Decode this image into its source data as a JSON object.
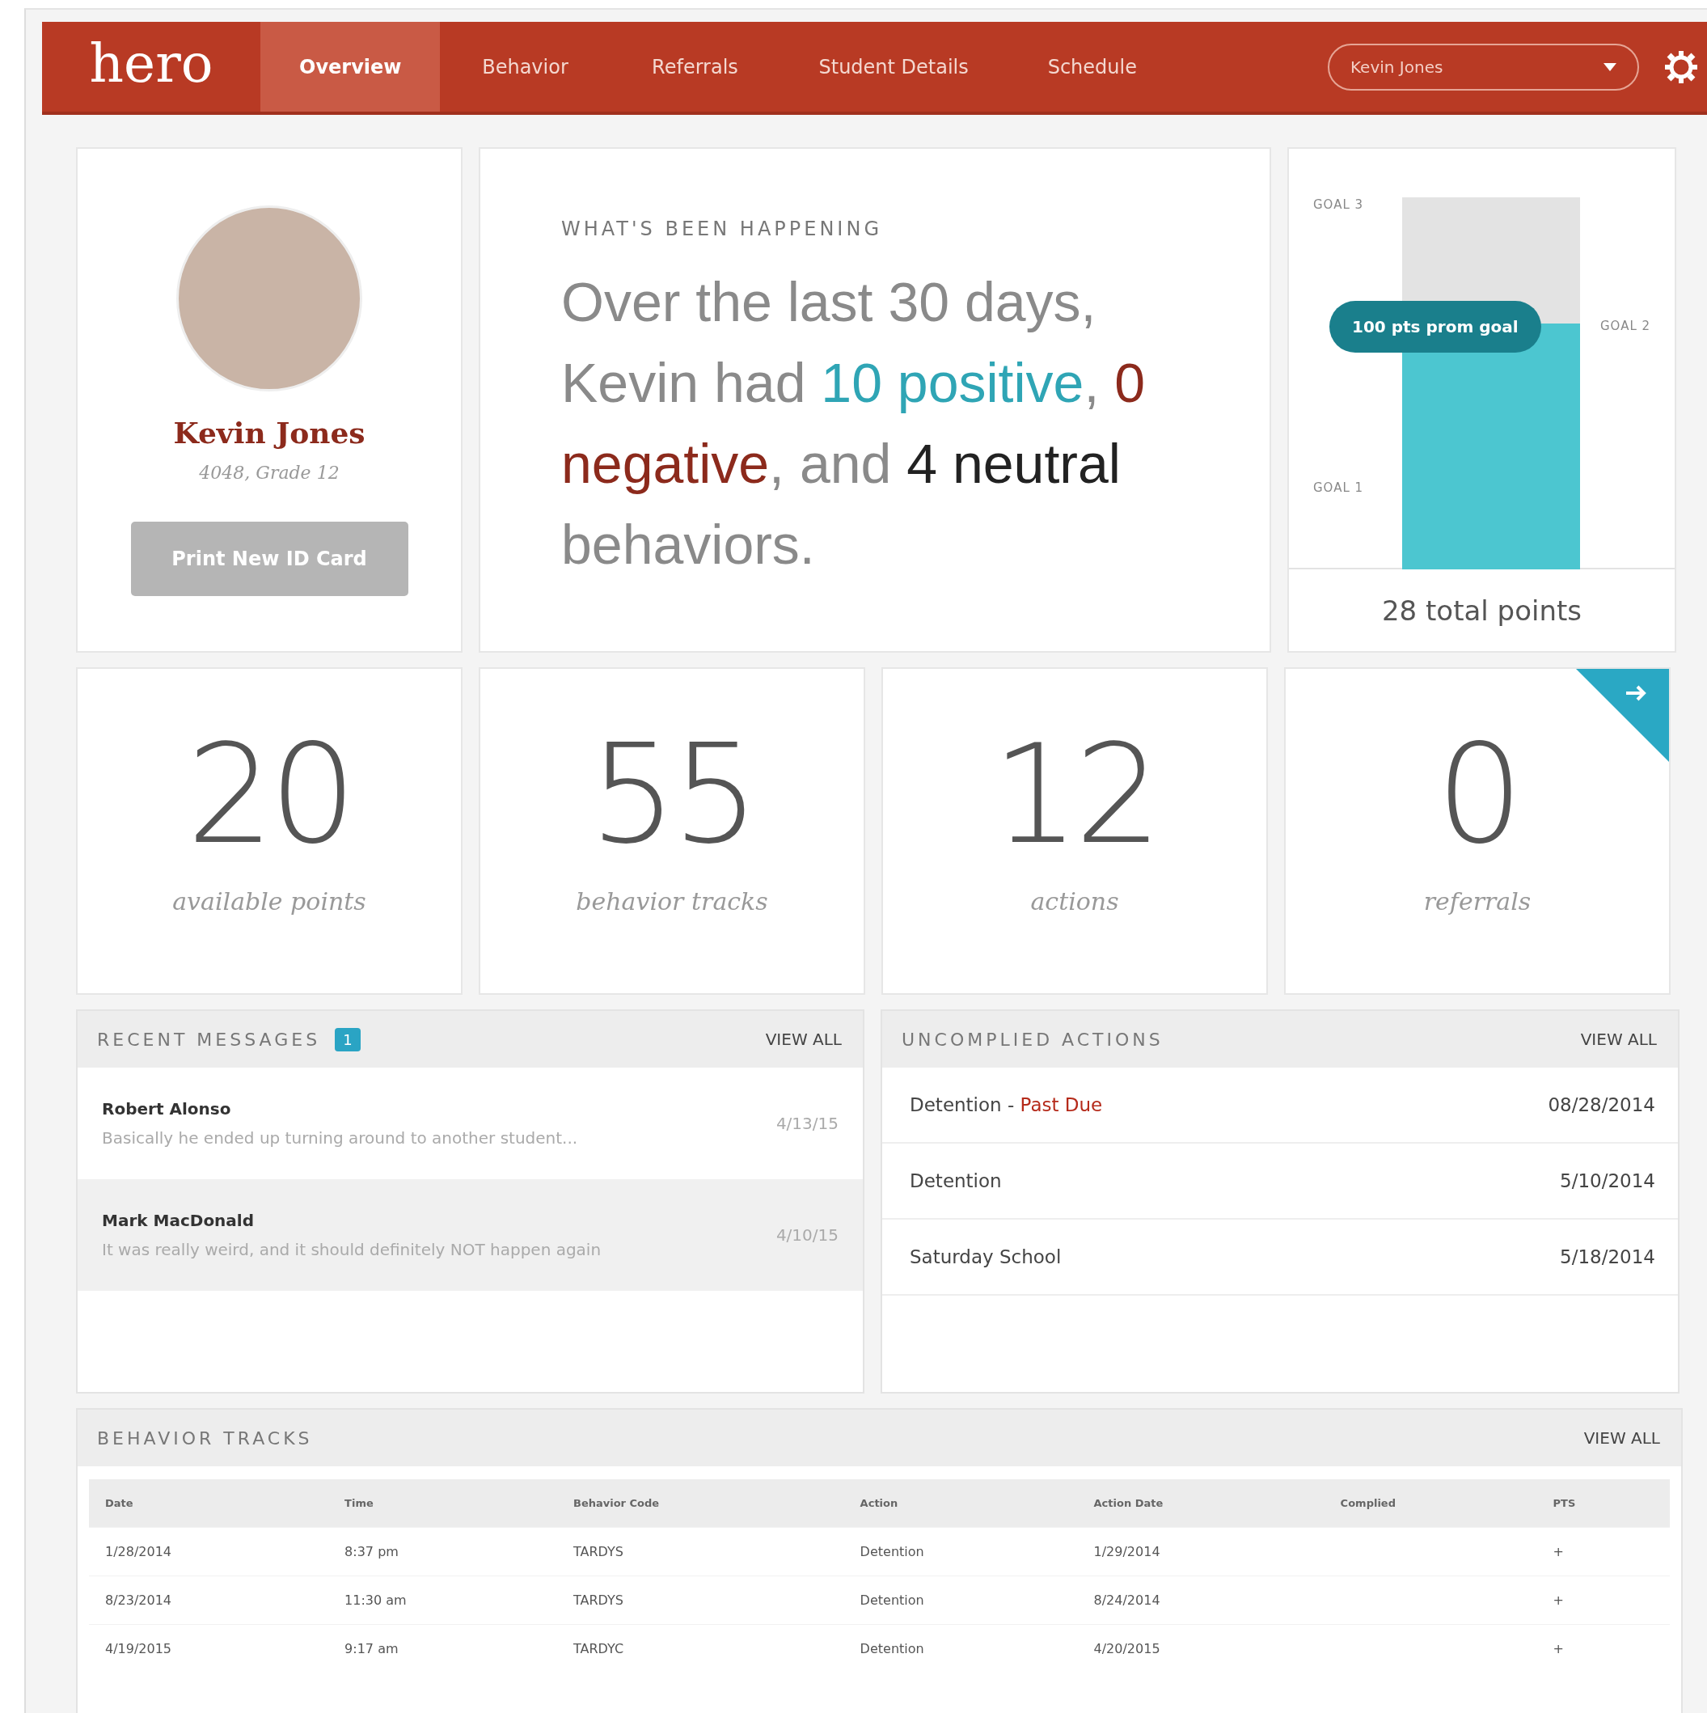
{
  "nav": {
    "logo": "hero",
    "tabs": [
      {
        "label": "Overview",
        "selected": true
      },
      {
        "label": "Behavior",
        "selected": false
      },
      {
        "label": "Referrals",
        "selected": false
      },
      {
        "label": "Student Details",
        "selected": false
      },
      {
        "label": "Schedule",
        "selected": false
      }
    ],
    "student_select": {
      "value": "Kevin Jones"
    }
  },
  "profile": {
    "name": "Kevin Jones",
    "details": "4048, Grade 12",
    "button": "Print New ID Card"
  },
  "summary": {
    "heading": "WHAT'S BEEN HAPPENING",
    "sentence": [
      {
        "kind": "plain",
        "text": "Over the last 30 days, Kevin had "
      },
      {
        "kind": "positive",
        "text": "10 positive"
      },
      {
        "kind": "plain",
        "text": ", "
      },
      {
        "kind": "negative",
        "text": "0 negative"
      },
      {
        "kind": "plain",
        "text": ", and "
      },
      {
        "kind": "neutral",
        "text": "4 neutral"
      },
      {
        "kind": "plain",
        "text": " behaviors."
      }
    ]
  },
  "goal_meter": {
    "level": 0.66,
    "goals": [
      "GOAL 3",
      "GOAL 2",
      "GOAL 1"
    ],
    "tooltip": "100 pts prom goal",
    "total": "28 total points"
  },
  "stats": [
    {
      "value": "20",
      "label": "available points",
      "link": false
    },
    {
      "value": "55",
      "label": "behavior tracks",
      "link": false
    },
    {
      "value": "12",
      "label": "actions",
      "link": false
    },
    {
      "value": "0",
      "label": "referrals",
      "link": true
    }
  ],
  "messages": {
    "title": "RECENT MESSAGES",
    "badge": "1",
    "view_all": "VIEW ALL",
    "items": [
      {
        "sender": "Robert Alonso",
        "preview": "Basically he ended up turning around to another student...",
        "date": "4/13/15",
        "selected": false
      },
      {
        "sender": "Mark MacDonald",
        "preview": "It was really weird, and it should definitely NOT happen again",
        "date": "4/10/15",
        "selected": true
      }
    ]
  },
  "actions": {
    "title": "UNCOMPLIED ACTIONS",
    "view_all": "VIEW ALL",
    "items": [
      {
        "name": "Detention",
        "separator": "-",
        "status": "Past Due",
        "date": "08/28/2014"
      },
      {
        "name": "Detention",
        "date": "5/10/2014"
      },
      {
        "name": "Saturday School",
        "date": "5/18/2014"
      }
    ]
  },
  "tracks": {
    "title": "BEHAVIOR TRACKS",
    "view_all": "VIEW ALL",
    "columns": [
      "Date",
      "Time",
      "Behavior Code",
      "Action",
      "Action Date",
      "Complied",
      "PTS"
    ],
    "rows": [
      {
        "date": "1/28/2014",
        "time": "8:37 pm",
        "behavior_code": "TARDYS",
        "action": "Detention",
        "action_date": "1/29/2014",
        "pts": "+"
      },
      {
        "date": "8/23/2014",
        "time": "11:30 am",
        "behavior_code": "TARDYS",
        "action": "Detention",
        "action_date": "8/24/2014",
        "pts": "+"
      },
      {
        "date": "4/19/2015",
        "time": "9:17 am",
        "behavior_code": "TARDYC",
        "action": "Detention",
        "action_date": "4/20/2015",
        "pts": "+"
      }
    ]
  }
}
